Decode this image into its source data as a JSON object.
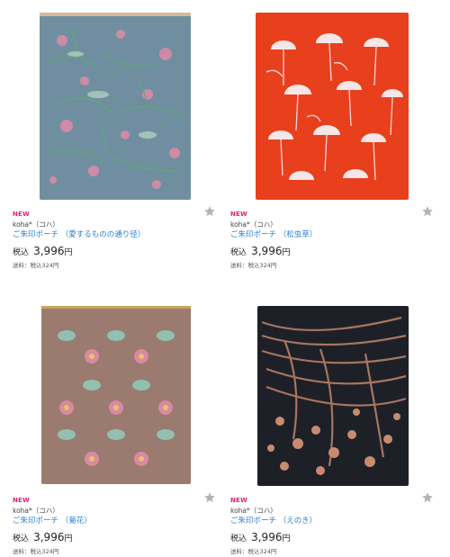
{
  "products": [
    {
      "badge": "NEW",
      "brand": "koha*（コハ）",
      "title": "ご朱印ポーチ （愛するものの通り径）",
      "price_label": "税込",
      "price": "3,996",
      "price_unit": "円",
      "shipping": "送料：税込324円",
      "favorite_icon": "star-icon",
      "colors": {
        "bg": "#6f8fa0",
        "accent": "#e08aa8",
        "leaf": "#5fa878",
        "zip": "#d8b79a"
      }
    },
    {
      "badge": "NEW",
      "brand": "koha*（コハ）",
      "title": "ご朱印ポーチ （松虫草）",
      "price_label": "税込",
      "price": "3,996",
      "price_unit": "円",
      "shipping": "送料：税込324円",
      "favorite_icon": "star-icon",
      "colors": {
        "bg": "#e8401c",
        "accent": "#f6e6e8",
        "leaf": "#f3d7da",
        "zip": "#e8401c"
      }
    },
    {
      "badge": "NEW",
      "brand": "koha*（コハ）",
      "title": "ご朱印ポーチ （菊花）",
      "price_label": "税込",
      "price": "3,996",
      "price_unit": "円",
      "shipping": "送料：税込324円",
      "favorite_icon": "star-icon",
      "colors": {
        "bg": "#9b7a70",
        "accent": "#d88aa0",
        "leaf": "#8fc8b8",
        "zip": "#c9a45a"
      }
    },
    {
      "badge": "NEW",
      "brand": "koha*（コハ）",
      "title": "ご朱印ポーチ （えのき）",
      "price_label": "税込",
      "price": "3,996",
      "price_unit": "円",
      "shipping": "送料：税込324円",
      "favorite_icon": "star-icon",
      "colors": {
        "bg": "#1e2028",
        "accent": "#c98a70",
        "leaf": "#b07a62",
        "zip": "#222"
      }
    }
  ]
}
